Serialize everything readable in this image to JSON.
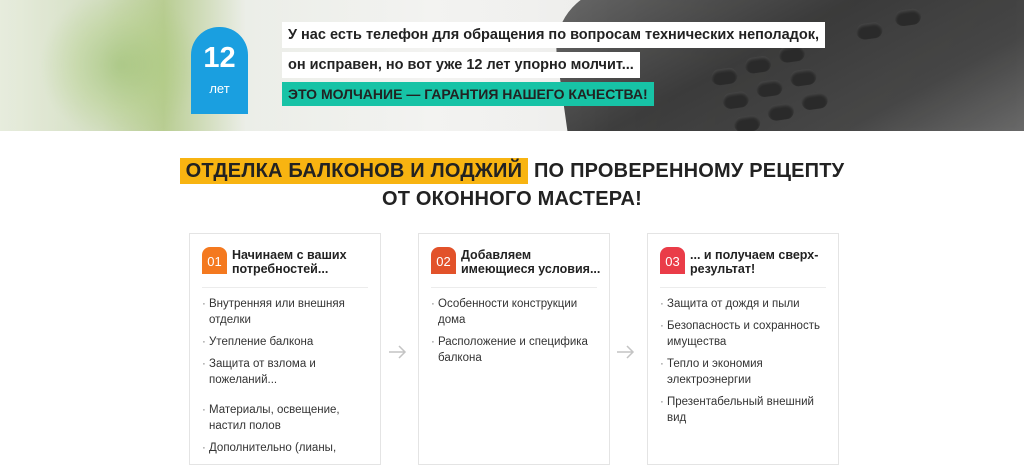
{
  "banner": {
    "years_number": "12",
    "years_unit": "лет",
    "line1": "У нас есть телефон для обращения по вопросам технических неполадок,",
    "line2": "он исправен, но вот уже 12 лет упорно молчит...",
    "accent": "ЭТО МОЛЧАНИЕ — ГАРАНТИЯ НАШЕГО КАЧЕСТВА!"
  },
  "heading": {
    "highlight": "ОТДЕЛКА БАЛКОНОВ И ЛОДЖИЙ",
    "rest": "ПО ПРОВЕРЕННОМУ РЕЦЕПТУ",
    "line2": "ОТ ОКОННОГО МАСТЕРА!"
  },
  "colors": {
    "accent_teal": "#17c3a6",
    "accent_orange": "#f8b411",
    "badge_blue": "#1a9fe0",
    "step1": "#f4791f",
    "step2": "#e2522a",
    "step3": "#ea3c48"
  },
  "steps": [
    {
      "num": "01",
      "title": "Начинаем с ваших потребностей...",
      "items": [
        "Внутренняя или внешняя отделки",
        "Утепление балкона",
        "Защита от взлома и пожеланий...",
        "Материалы, освещение, настил полов",
        "Дополнительно (лианы,"
      ]
    },
    {
      "num": "02",
      "title": "Добавляем имеющиеся условия...",
      "items": [
        "Особенности конструкции дома",
        "Расположение и специфика балкона"
      ]
    },
    {
      "num": "03",
      "title": "... и получаем сверх-результат!",
      "items": [
        "Защита от дождя и пыли",
        "Безопасность и сохранность имущества",
        "Тепло и экономия электроэнергии",
        "Презентабельный внешний вид"
      ]
    }
  ],
  "arrow_icon": "arrow-right-icon"
}
